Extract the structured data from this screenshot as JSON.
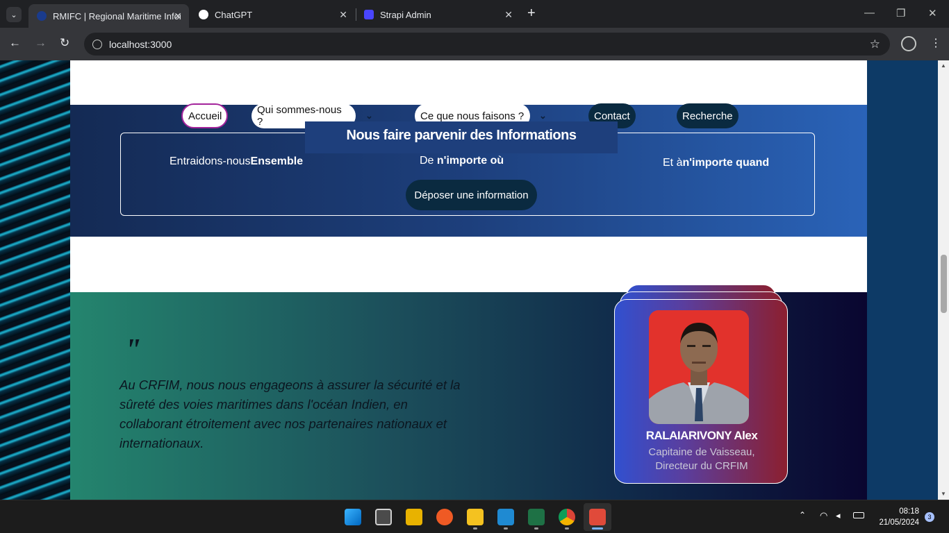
{
  "browser": {
    "tabs": [
      {
        "title": "RMIFC | Regional Maritime Infor",
        "active": true
      },
      {
        "title": "ChatGPT",
        "active": false
      },
      {
        "title": "Strapi Admin",
        "active": false
      }
    ],
    "new_tab_label": "+",
    "url": "localhost:3000"
  },
  "site": {
    "nav": {
      "accueil": "Accueil",
      "qui": "Qui sommes-nous ?",
      "que": "Ce que nous faisons ?",
      "contact": "Contact",
      "recherche": "Recherche"
    },
    "info": {
      "heading": "Nous faire parvenir des Informations",
      "col1_plain": "Entraidons-nous",
      "col1_bold": "Ensemble",
      "col2_plain": "De ",
      "col2_bold": "n'importe où",
      "col3_plain": "Et à",
      "col3_bold": "n'importe quand",
      "button": "Déposer une information"
    },
    "quote": {
      "mark": "\"",
      "text": "Au CRFIM, nous nous engageons à assurer la sécurité et la sûreté des voies maritimes dans l'océan Indien, en collaborant étroitement avec nos partenaires nationaux et internationaux."
    },
    "person": {
      "name": "RALAIARIVONY Alex",
      "role_line1": "Capitaine de Vaisseau,",
      "role_line2": "Directeur du CRFIM"
    }
  },
  "taskbar": {
    "time": "08:18",
    "date": "21/05/2024",
    "notifications": "3"
  },
  "colors": {
    "band_start": "#142a54",
    "band_end": "#2a63b8",
    "nav_dark": "#0a2a40",
    "active_border": "#a3239b",
    "card_start": "#3150cf",
    "card_end": "#8c1f2f"
  }
}
